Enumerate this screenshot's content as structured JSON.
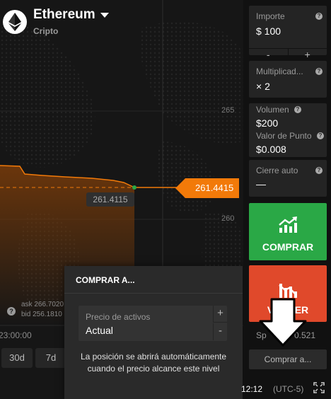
{
  "asset": {
    "name": "Ethereum",
    "category": "Cripto"
  },
  "chart": {
    "y_ticks": [
      "265",
      "260"
    ],
    "current_price": "261.4415",
    "hover_price": "261.4115",
    "ask_label": "ask 266.7020",
    "bid_label": "bid 256.1810",
    "time_label": "23:00:00",
    "ranges": [
      "30d",
      "7d"
    ],
    "colors": {
      "line": "#f27a09",
      "area": "#7a3c0a",
      "current_dot": "#2aa846"
    }
  },
  "popup": {
    "title": "COMPRAR A...",
    "field_label": "Precio de activos",
    "field_value": "Actual",
    "plus": "+",
    "minus": "-",
    "note": "La posición se abrirá automáticamente cuando el precio alcance este nivel"
  },
  "panel": {
    "amount_label": "Importe",
    "amount_value": "$  100",
    "minus": "-",
    "plus": "+",
    "multiplier_label": "Multiplicad...",
    "multiplier_value": "× 2",
    "volume_label": "Volumen",
    "volume_value": "$200",
    "point_value_label": "Valor de Punto",
    "point_value_value": "$0.008",
    "autoclose_label": "Cierre auto",
    "autoclose_value": "—",
    "buy_label": "COMPRAR",
    "sell_label": "VENDER",
    "spread_label": "Sp",
    "spread_value": "0.521",
    "buy_at_label": "Comprar a...",
    "clock": "12:12",
    "timezone": "(UTC-5)",
    "colors": {
      "buy": "#2aa846",
      "sell": "#e0492b"
    }
  }
}
